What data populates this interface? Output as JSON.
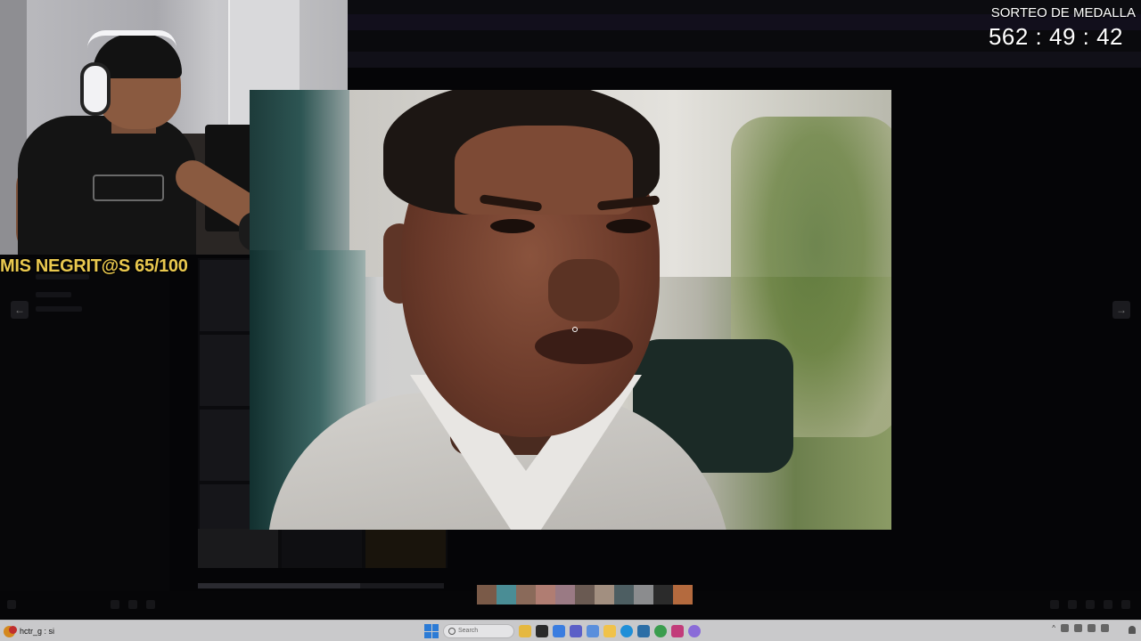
{
  "stream_overlay": {
    "rating_text": "MIS NEGRIT@S 65/100",
    "giveaway_title": "SORTEO DE MEDALLA",
    "giveaway_countdown": "562 : 49 : 42"
  },
  "viewer": {
    "prev_glyph": "←",
    "next_glyph": "→",
    "filmstrip_colors": [
      "#7a5a48",
      "#4a8d95",
      "#8a6a5a",
      "#b07d72",
      "#9a7a84",
      "#6a5a52",
      "#a28f80",
      "#4d5e62",
      "#8b8c8e",
      "#2b2b2b",
      "#b46a3e"
    ]
  },
  "taskbar": {
    "widget_label": "hctr_g : si",
    "search_placeholder": "Search",
    "app_icons": [
      {
        "name": "file-explorer-icon",
        "color": "#e5b840"
      },
      {
        "name": "terminal-icon",
        "color": "#2a2a2a"
      },
      {
        "name": "photos-icon",
        "color": "#3a7de0"
      },
      {
        "name": "teams-icon",
        "color": "#5b5fc7"
      },
      {
        "name": "store-icon",
        "color": "#5a8fdc"
      },
      {
        "name": "folder-icon",
        "color": "#f0c24a"
      },
      {
        "name": "edge-icon",
        "color": "#1f8fd8"
      },
      {
        "name": "calculator-icon",
        "color": "#2c6ea6"
      },
      {
        "name": "chrome-icon",
        "color": "#3a9d4e"
      },
      {
        "name": "paint-icon",
        "color": "#c23b7a"
      },
      {
        "name": "discord-icon",
        "color": "#8a6bd8"
      }
    ]
  },
  "colors": {
    "overlay_text": "#e9c84f",
    "app_background": "#050507",
    "taskbar": "#c9c9cb"
  }
}
